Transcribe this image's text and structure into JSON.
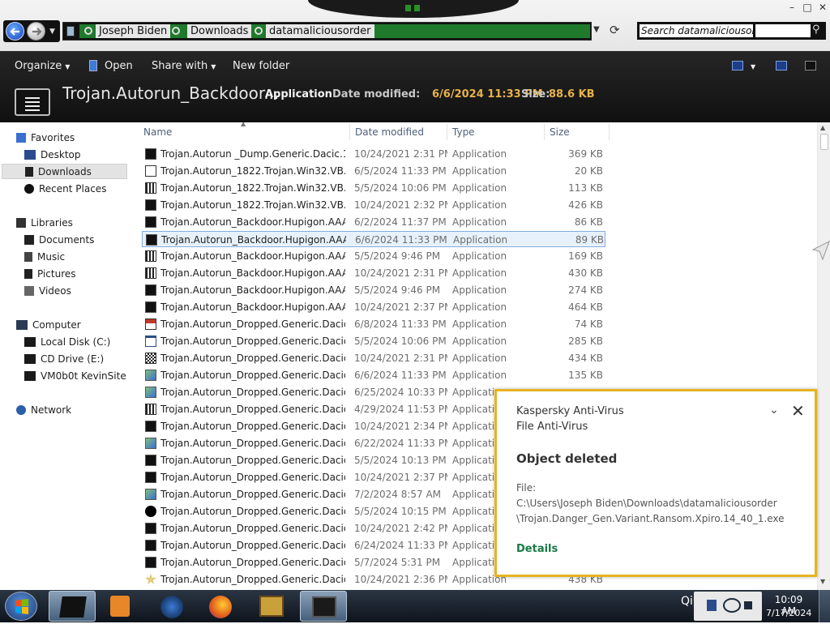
{
  "window": {
    "controls": {
      "minimize": "–",
      "maximize": "□",
      "close": "✕"
    }
  },
  "address": {
    "crumbs": [
      "Joseph Biden",
      "Downloads",
      "datamaliciousorder"
    ]
  },
  "search": {
    "placeholder": "Search datamaliciousorder"
  },
  "toolbar": {
    "organize": "Organize",
    "open": "Open",
    "share_with": "Share with",
    "new_folder": "New folder"
  },
  "details": {
    "file_name": "Trojan.Autorun_Backdoor...",
    "file_type": "Application",
    "date_label": "Date modified:",
    "date_value": "6/6/2024 11:33 PM",
    "size_label": "Size:",
    "size_value": "88.6 KB"
  },
  "sidebar": {
    "favorites": "Favorites",
    "desktop": "Desktop",
    "downloads": "Downloads",
    "recent": "Recent Places",
    "libraries": "Libraries",
    "documents": "Documents",
    "music": "Music",
    "pictures": "Pictures",
    "videos": "Videos",
    "computer": "Computer",
    "local_disk": "Local Disk (C:)",
    "cd_drive": "CD Drive (E:)",
    "vm": "VM0b0t KevinSite",
    "network": "Network"
  },
  "columns": {
    "name": "Name",
    "date": "Date modified",
    "type": "Type",
    "size": "Size"
  },
  "files": [
    {
      "name": "Trojan.Autorun _Dump.Generic.Dacic.19...",
      "date": "10/24/2021 2:31 PM",
      "type": "Application",
      "size": "369 KB",
      "icon": "dark"
    },
    {
      "name": "Trojan.Autorun_1822.Trojan.Win32.VB.kp...",
      "date": "6/5/2024 11:33 PM",
      "type": "Application",
      "size": "20 KB",
      "icon": "shortcut"
    },
    {
      "name": "Trojan.Autorun_1822.Trojan.Win32.VB.kp...",
      "date": "5/5/2024 10:06 PM",
      "type": "Application",
      "size": "113 KB",
      "icon": "grid"
    },
    {
      "name": "Trojan.Autorun_1822.Trojan.Win32.VB.kp...",
      "date": "10/24/2021 2:32 PM",
      "type": "Application",
      "size": "426 KB",
      "icon": "dark"
    },
    {
      "name": "Trojan.Autorun_Backdoor.Hupigon.AAA...",
      "date": "6/2/2024 11:37 PM",
      "type": "Application",
      "size": "86 KB",
      "icon": "dark"
    },
    {
      "name": "Trojan.Autorun_Backdoor.Hupigon.AAA...",
      "date": "6/6/2024 11:33 PM",
      "type": "Application",
      "size": "89 KB",
      "icon": "dark",
      "selected": true
    },
    {
      "name": "Trojan.Autorun_Backdoor.Hupigon.AAA...",
      "date": "5/5/2024 9:46 PM",
      "type": "Application",
      "size": "169 KB",
      "icon": "grid"
    },
    {
      "name": "Trojan.Autorun_Backdoor.Hupigon.AAA...",
      "date": "10/24/2021 2:31 PM",
      "type": "Application",
      "size": "430 KB",
      "icon": "grid"
    },
    {
      "name": "Trojan.Autorun_Backdoor.Hupigon.AAA...",
      "date": "5/5/2024 9:46 PM",
      "type": "Application",
      "size": "274 KB",
      "icon": "dark"
    },
    {
      "name": "Trojan.Autorun_Backdoor.Hupigon.AAA...",
      "date": "10/24/2021 2:37 PM",
      "type": "Application",
      "size": "464 KB",
      "icon": "dark"
    },
    {
      "name": "Trojan.Autorun_Dropped.Generic.Dacic.1...",
      "date": "6/8/2024 11:33 PM",
      "type": "Application",
      "size": "74 KB",
      "icon": "red"
    },
    {
      "name": "Trojan.Autorun_Dropped.Generic.Dacic.1...",
      "date": "5/5/2024 10:06 PM",
      "type": "Application",
      "size": "285 KB",
      "icon": "window"
    },
    {
      "name": "Trojan.Autorun_Dropped.Generic.Dacic.1...",
      "date": "10/24/2021 2:31 PM",
      "type": "Application",
      "size": "434 KB",
      "icon": "checker"
    },
    {
      "name": "Trojan.Autorun_Dropped.Generic.Dacic.0...",
      "date": "6/6/2024 11:33 PM",
      "type": "Application",
      "size": "135 KB",
      "icon": "setup"
    },
    {
      "name": "Trojan.Autorun_Dropped.Generic.Dacic.0...",
      "date": "6/25/2024 10:33 PM",
      "type": "Application",
      "size": "",
      "icon": "setup"
    },
    {
      "name": "Trojan.Autorun_Dropped.Generic.Dacic.0...",
      "date": "4/29/2024 11:53 PM",
      "type": "Application",
      "size": "",
      "icon": "grid"
    },
    {
      "name": "Trojan.Autorun_Dropped.Generic.Dacic.0...",
      "date": "10/24/2021 2:34 PM",
      "type": "Application",
      "size": "",
      "icon": "dark"
    },
    {
      "name": "Trojan.Autorun_Dropped.Generic.Dacic.0...",
      "date": "6/22/2024 11:33 PM",
      "type": "Application",
      "size": "",
      "icon": "setup"
    },
    {
      "name": "Trojan.Autorun_Dropped.Generic.Dacic.0...",
      "date": "5/5/2024 10:13 PM",
      "type": "Application",
      "size": "",
      "icon": "dark"
    },
    {
      "name": "Trojan.Autorun_Dropped.Generic.Dacic.0...",
      "date": "10/24/2021 2:37 PM",
      "type": "Application",
      "size": "",
      "icon": "dark"
    },
    {
      "name": "Trojan.Autorun_Dropped.Generic.Dacic.0...",
      "date": "7/2/2024 8:57 AM",
      "type": "Application",
      "size": "",
      "icon": "setup"
    },
    {
      "name": "Trojan.Autorun_Dropped.Generic.Dacic.0...",
      "date": "5/5/2024 10:15 PM",
      "type": "Application",
      "size": "",
      "icon": "black"
    },
    {
      "name": "Trojan.Autorun_Dropped.Generic.Dacic.0...",
      "date": "10/24/2021 2:42 PM",
      "type": "Application",
      "size": "",
      "icon": "dark"
    },
    {
      "name": "Trojan.Autorun_Dropped.Generic.Dacic.0...",
      "date": "6/24/2024 11:33 PM",
      "type": "Application",
      "size": "",
      "icon": "dark"
    },
    {
      "name": "Trojan.Autorun_Dropped.Generic.Dacic.0...",
      "date": "5/7/2024 5:31 PM",
      "type": "Application",
      "size": "",
      "icon": "dark"
    },
    {
      "name": "Trojan.Autorun_Dropped.Generic.Dacic.0...",
      "date": "10/24/2021 2:36 PM",
      "type": "Application",
      "size": "438 KB",
      "icon": "star"
    }
  ],
  "toast": {
    "app": "Kaspersky Anti-Virus",
    "component": "File Anti-Virus",
    "title": "Object deleted",
    "file_label": "File:",
    "path_line1": "C:\\Users\\Joseph Biden\\Downloads\\datamaliciousorder",
    "path_line2": "\\Trojan.Danger_Gen.Variant.Ransom.Xpiro.14_40_1.exe",
    "details": "Details",
    "accent": "#e6b422",
    "link_color": "#1a7a45"
  },
  "taskbar": {
    "time": "10:09 AM",
    "date": "7/17/2024",
    "tray_text": "Qi",
    "apps": [
      "explorer",
      "media-player",
      "earth",
      "firefox",
      "sandboxie",
      "monitor"
    ]
  }
}
